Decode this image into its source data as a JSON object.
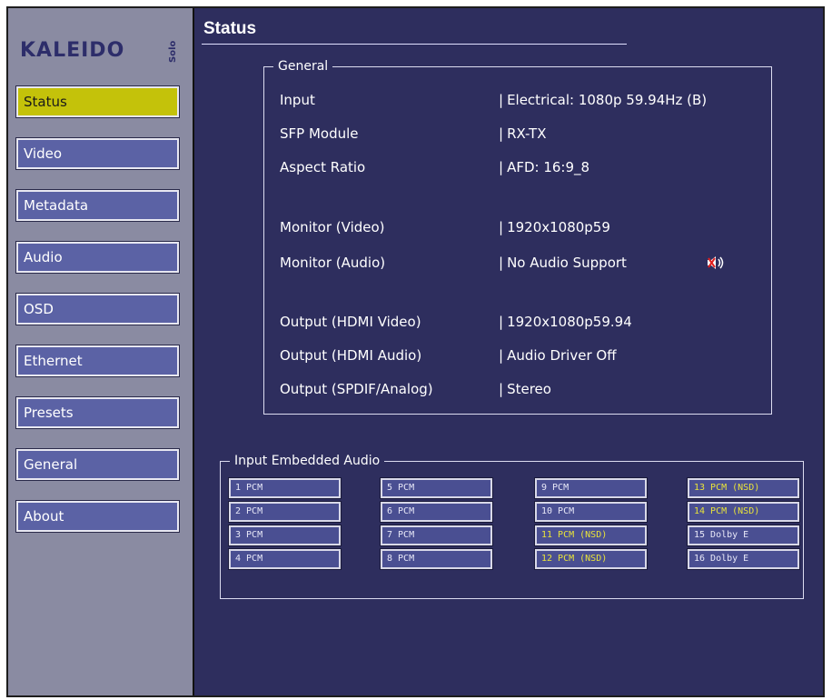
{
  "logo": {
    "main": "KALEIDO",
    "sub": "Solo"
  },
  "sidebar": {
    "items": [
      {
        "label": "Status",
        "active": true
      },
      {
        "label": "Video",
        "active": false
      },
      {
        "label": "Metadata",
        "active": false
      },
      {
        "label": "Audio",
        "active": false
      },
      {
        "label": "OSD",
        "active": false
      },
      {
        "label": "Ethernet",
        "active": false
      },
      {
        "label": "Presets",
        "active": false
      },
      {
        "label": "General",
        "active": false
      },
      {
        "label": "About",
        "active": false
      }
    ]
  },
  "page": {
    "title": "Status"
  },
  "general": {
    "legend": "General",
    "rows": [
      {
        "label": "Input",
        "value": "Electrical: 1080p 59.94Hz (B)"
      },
      {
        "label": "SFP Module",
        "value": "RX-TX"
      },
      {
        "label": "Aspect Ratio",
        "value": "AFD: 16:9_8"
      },
      {
        "label": "Monitor (Video)",
        "value": "1920x1080p59"
      },
      {
        "label": "Monitor (Audio)",
        "value": "No Audio Support"
      },
      {
        "label": "Output (HDMI Video)",
        "value": "1920x1080p59.94"
      },
      {
        "label": "Output (HDMI Audio)",
        "value": "Audio Driver Off"
      },
      {
        "label": "Output (SPDIF/Analog)",
        "value": "Stereo"
      }
    ],
    "speaker_icon": "speaker-muted-icon"
  },
  "embedded_audio": {
    "legend": "Input Embedded Audio",
    "channels": [
      {
        "label": "1 PCM",
        "nsd": false
      },
      {
        "label": "2 PCM",
        "nsd": false
      },
      {
        "label": "3 PCM",
        "nsd": false
      },
      {
        "label": "4 PCM",
        "nsd": false
      },
      {
        "label": "5 PCM",
        "nsd": false
      },
      {
        "label": "6 PCM",
        "nsd": false
      },
      {
        "label": "7 PCM",
        "nsd": false
      },
      {
        "label": "8 PCM",
        "nsd": false
      },
      {
        "label": "9 PCM",
        "nsd": false
      },
      {
        "label": "10 PCM",
        "nsd": false
      },
      {
        "label": "11 PCM (NSD)",
        "nsd": true
      },
      {
        "label": "12 PCM (NSD)",
        "nsd": true
      },
      {
        "label": "13 PCM (NSD)",
        "nsd": true
      },
      {
        "label": "14 PCM (NSD)",
        "nsd": true
      },
      {
        "label": "15 Dolby E",
        "nsd": false
      },
      {
        "label": "16 Dolby E",
        "nsd": false
      }
    ]
  },
  "colors": {
    "background": "#2e2e5e",
    "sidebar": "#8a8ba2",
    "nav_button": "#5b62a5",
    "nav_active": "#c4c20a",
    "nsd_text": "#e8e33a"
  }
}
